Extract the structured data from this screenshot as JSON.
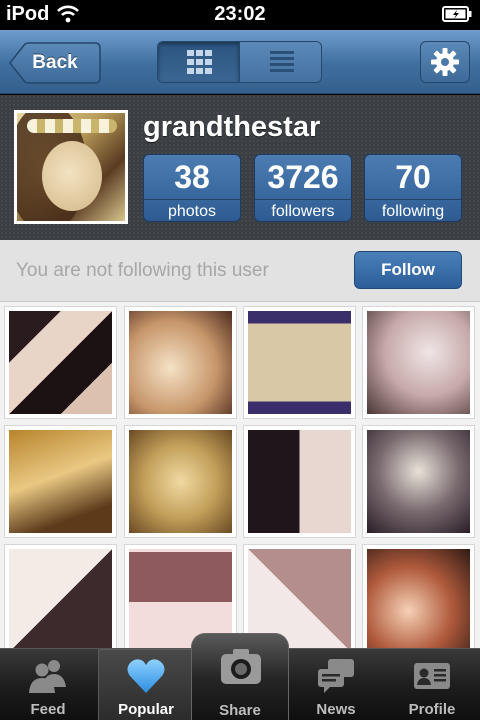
{
  "status_bar": {
    "carrier": "iPod",
    "time": "23:02"
  },
  "nav": {
    "back_label": "Back"
  },
  "profile": {
    "username": "grandthestar",
    "stats": [
      {
        "value": "38",
        "label": "photos"
      },
      {
        "value": "3726",
        "label": "followers"
      },
      {
        "value": "70",
        "label": "following"
      }
    ]
  },
  "follow": {
    "message": "You are not following this user",
    "button_label": "Follow"
  },
  "tabs": [
    {
      "label": "Feed",
      "icon": "people-icon"
    },
    {
      "label": "Popular",
      "icon": "heart-icon"
    },
    {
      "label": "Share",
      "icon": "camera-icon"
    },
    {
      "label": "News",
      "icon": "speech-bubbles-icon"
    },
    {
      "label": "Profile",
      "icon": "id-card-icon"
    }
  ],
  "colors": {
    "nav_blue": "#3f6f9f",
    "stat_blue": "#2e5c92",
    "heart_blue": "#3fa0ec"
  }
}
